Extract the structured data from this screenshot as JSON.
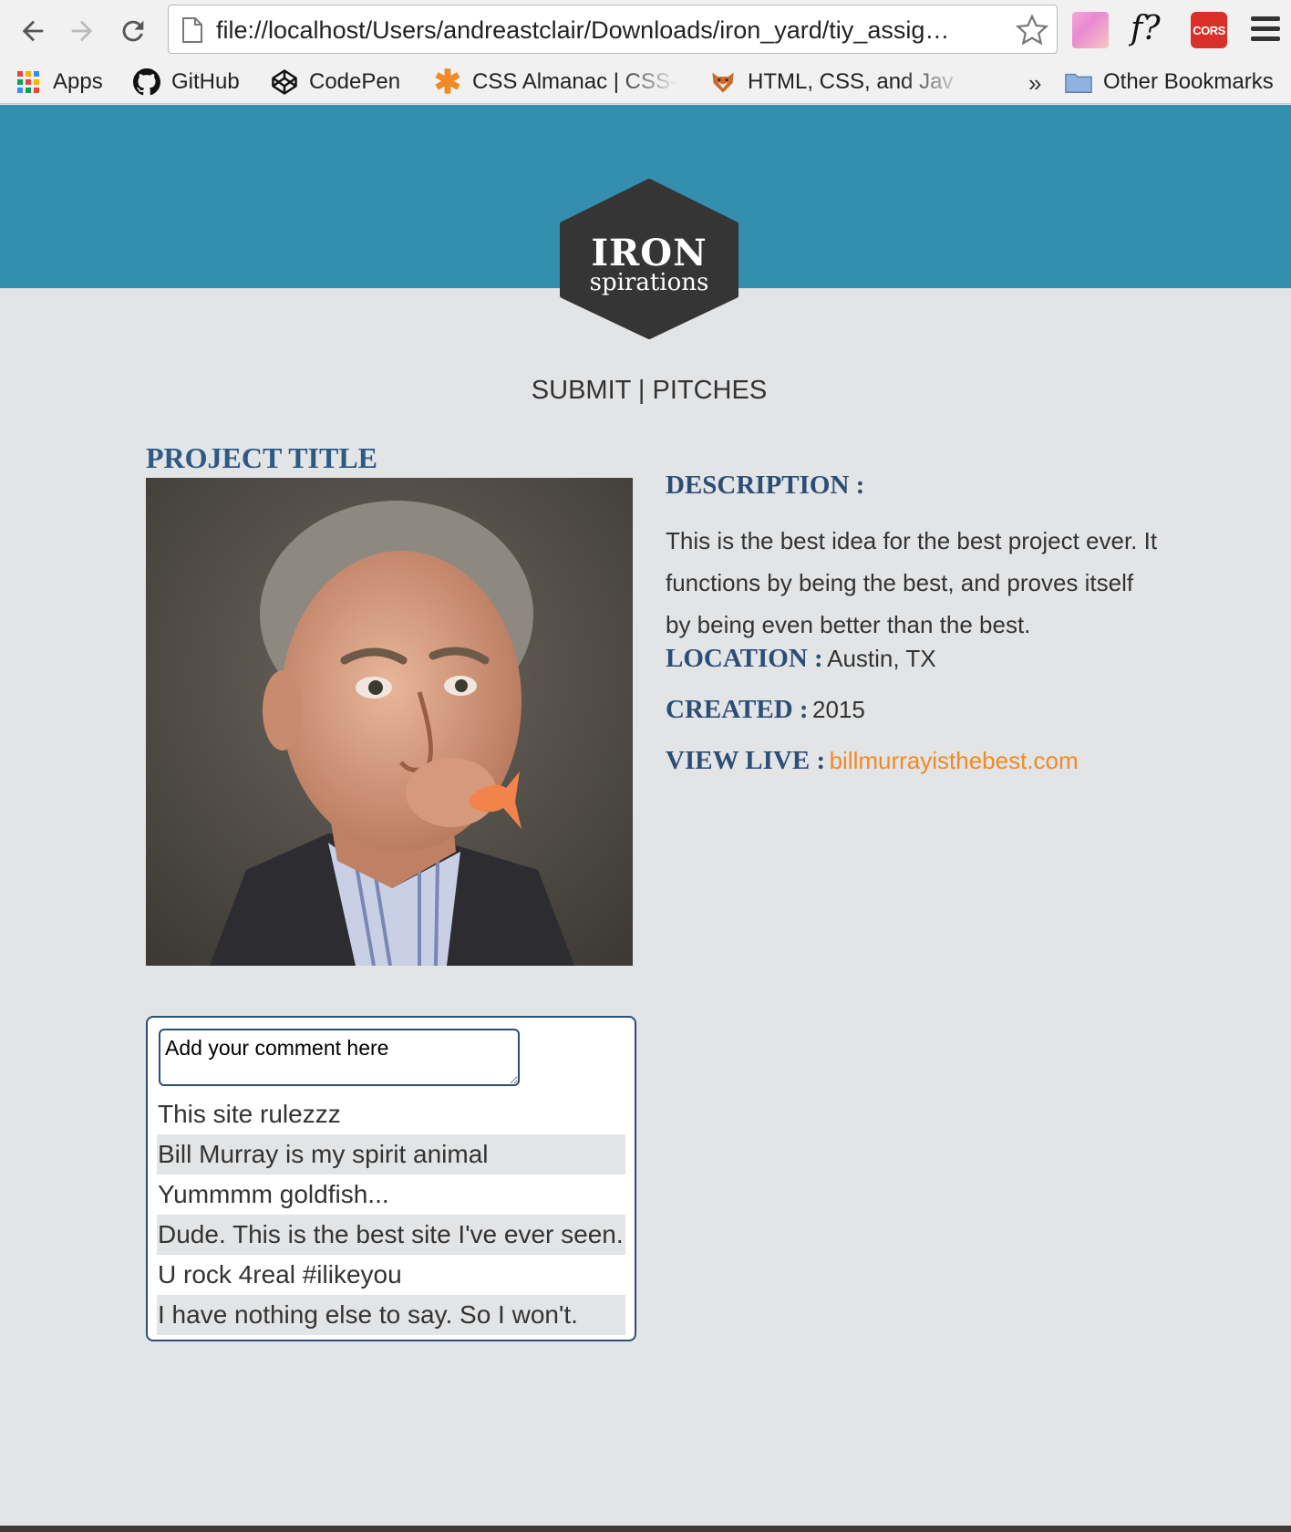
{
  "browser": {
    "url": "file://localhost/Users/andreastclair/Downloads/iron_yard/tiy_assig…",
    "extensions": {
      "fquery_label": "f?",
      "cors_label": "CORS"
    },
    "bookmarks": [
      {
        "label": "Apps",
        "icon": "apps-grid-icon"
      },
      {
        "label": "GitHub",
        "icon": "github-icon"
      },
      {
        "label": "CodePen",
        "icon": "codepen-icon"
      },
      {
        "label": "CSS Almanac | CSS-",
        "icon": "asterisk-icon"
      },
      {
        "label": "HTML, CSS, and Jav",
        "icon": "fox-icon"
      }
    ],
    "overflow_label": "»",
    "other_bookmarks": "Other Bookmarks"
  },
  "logo": {
    "line1": "IRON",
    "line2": "spirations"
  },
  "nav": {
    "submit": "SUBMIT",
    "separator": " | ",
    "pitches": "PITCHES"
  },
  "project": {
    "title": "PROJECT TITLE",
    "description_label": "DESCRIPTION :",
    "description": "This is the best idea for the best project ever. It functions by being the best, and proves itself by being even better than the best.",
    "location_label": "LOCATION :",
    "location": "Austin, TX",
    "created_label": "CREATED :",
    "created": "2015",
    "view_live_label": "VIEW LIVE :",
    "view_live_link": "billmurrayisthebest.com"
  },
  "comments": {
    "placeholder": "Add your comment here",
    "items": [
      "This site rulezzz",
      "Bill Murray is my spirit animal",
      "Yummmm goldfish...",
      "Dude. This is the best site I've ever seen.",
      "U rock 4real #ilikeyou",
      "I have nothing else to say. So I won't."
    ]
  },
  "colors": {
    "hero": "#348eae",
    "heading": "#2b4e77",
    "link": "#f08a24",
    "page_bg": "#e3e4e6"
  }
}
